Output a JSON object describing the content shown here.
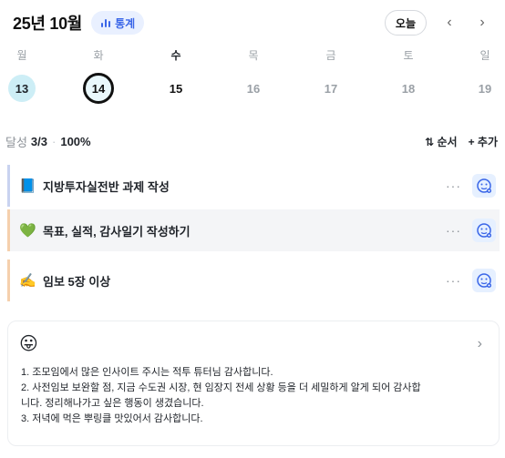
{
  "header": {
    "month_label": "25년 10월",
    "stats_label": "통계",
    "today_label": "오늘",
    "prev_icon": "chevron-left-icon",
    "next_icon": "chevron-right-icon"
  },
  "week": [
    {
      "dow": "월",
      "date": "13",
      "state": "past"
    },
    {
      "dow": "화",
      "date": "14",
      "state": "selected"
    },
    {
      "dow": "수",
      "date": "15",
      "state": "current"
    },
    {
      "dow": "목",
      "date": "16",
      "state": "future"
    },
    {
      "dow": "금",
      "date": "17",
      "state": "future"
    },
    {
      "dow": "토",
      "date": "18",
      "state": "future"
    },
    {
      "dow": "일",
      "date": "19",
      "state": "future"
    }
  ],
  "summary": {
    "label": "달성",
    "count": "3/3",
    "percent": "100%",
    "sort_label": "⇅ 순서",
    "add_label": "+ 추가"
  },
  "tasks": [
    {
      "emoji": "📘",
      "title": "지방투자실전반 과제 작성"
    },
    {
      "emoji": "💚",
      "title": "목표, 실적, 감사일기 작성하기"
    },
    {
      "emoji": "✍️",
      "title": "임보 5장 이상"
    }
  ],
  "journal": {
    "emoji": "😛",
    "lines": [
      "1. 조모임에서 많은 인사이트 주시는 적투 튜터님 감사합니다.",
      "2. 사전임보 보완할 점, 지금 수도권 시장, 현 임장지 전세 상황 등을 더 세밀하게 알게 되어 감사합",
      "니다. 정리해나가고 싶은 행동이 생겼습니다.",
      "3. 저녁에 먹은 뿌링클 맛있어서 감사합니다."
    ]
  },
  "colors": {
    "accent": "#3a66e8",
    "today_fill": "#cdeef6"
  }
}
